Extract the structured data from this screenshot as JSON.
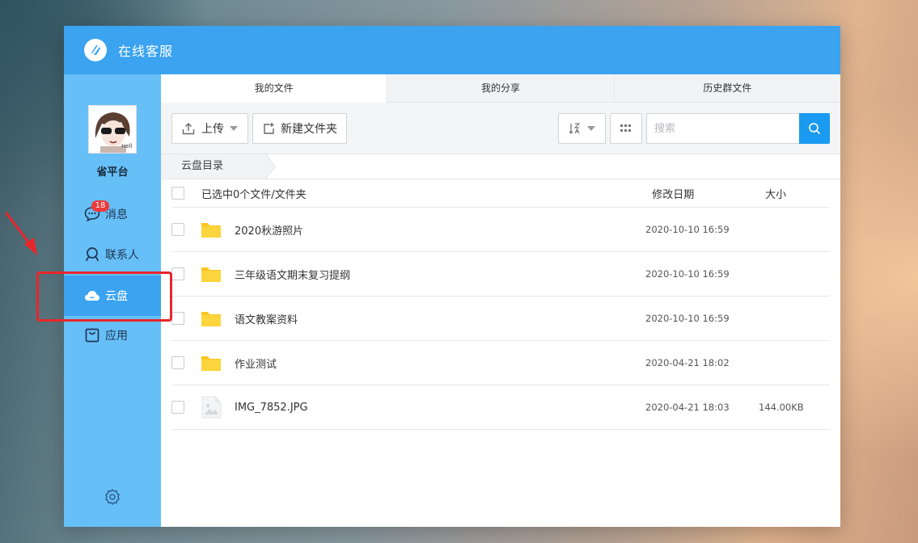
{
  "app": {
    "title": "在线客服"
  },
  "sidebar": {
    "username": "省平台",
    "items": [
      {
        "label": "消息",
        "icon": "chat-icon",
        "badge": "18"
      },
      {
        "label": "联系人",
        "icon": "contact-icon"
      },
      {
        "label": "云盘",
        "icon": "cloud-icon",
        "active": true
      },
      {
        "label": "应用",
        "icon": "shop-bag-icon"
      }
    ],
    "settings_icon": "gear-icon"
  },
  "tabs": [
    {
      "label": "我的文件",
      "active": true
    },
    {
      "label": "我的分享"
    },
    {
      "label": "历史群文件"
    }
  ],
  "toolbar": {
    "upload_label": "上传",
    "newfolder_label": "新建文件夹",
    "search_placeholder": "搜索"
  },
  "breadcrumb": {
    "label": "云盘目录"
  },
  "list": {
    "header": {
      "selection": "已选中0个文件/文件夹",
      "date": "修改日期",
      "size": "大小"
    },
    "rows": [
      {
        "name": "2020秋游照片",
        "date": "2020-10-10 16:59",
        "size": "",
        "type": "folder"
      },
      {
        "name": "三年级语文期末复习提纲",
        "date": "2020-10-10 16:59",
        "size": "",
        "type": "folder"
      },
      {
        "name": "语文教案资料",
        "date": "2020-10-10 16:59",
        "size": "",
        "type": "folder"
      },
      {
        "name": "作业测试",
        "date": "2020-04-21 18:02",
        "size": "",
        "type": "folder"
      },
      {
        "name": "IMG_7852.JPG",
        "date": "2020-04-21 18:03",
        "size": "144.00KB",
        "type": "image"
      }
    ]
  },
  "colors": {
    "titlebar": "#3ba3ef",
    "sidebar": "#67bff8",
    "active": "#3ba3ef",
    "badge": "#ee3a3a",
    "folder": "#f9c623",
    "annotation": "#e8262a"
  }
}
